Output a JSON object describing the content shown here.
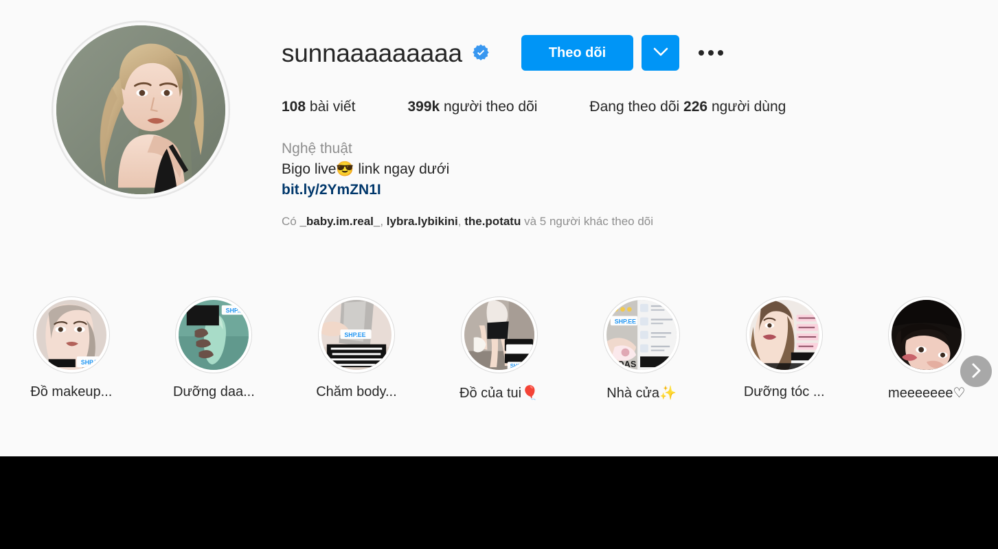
{
  "profile": {
    "username": "sunnaaaaaaaaa",
    "verified": true,
    "verified_icon": "verified-badge-icon",
    "avatar_alt": "profile-photo"
  },
  "actions": {
    "follow_label": "Theo dõi",
    "dropdown_icon": "chevron-down-icon",
    "more_icon": "more-options-icon",
    "accent_color": "#0095f6"
  },
  "stats": {
    "posts": {
      "count": "108",
      "label": "bài viết"
    },
    "followers": {
      "count": "399k",
      "label": "người theo dõi"
    },
    "following": {
      "prefix": "Đang theo dõi",
      "count": "226",
      "label": "người dùng"
    }
  },
  "bio": {
    "category": "Nghệ thuật",
    "line_text_before": "Bigo live",
    "line_emoji": "😎",
    "line_text_after": " link ngay dưới",
    "link": "bit.ly/2YmZN1I",
    "link_color": "#00376b"
  },
  "followed_by": {
    "prefix": "Có",
    "mutuals": [
      "_baby.im.real_",
      "lybra.lybikini",
      "the.potatu"
    ],
    "suffix": "và 5 người khác theo dõi"
  },
  "highlights": [
    {
      "label": "Đồ makeup...",
      "thumb": "makeup-thumb"
    },
    {
      "label": "Dưỡng daa...",
      "thumb": "skincare-thumb"
    },
    {
      "label": "Chăm body...",
      "thumb": "body-thumb"
    },
    {
      "label": "Đồ của tui🎈",
      "thumb": "outfit-thumb"
    },
    {
      "label": "Nhà cửa✨",
      "thumb": "home-thumb"
    },
    {
      "label": "Dưỡng tóc ...",
      "thumb": "hair-thumb"
    },
    {
      "label": "meeeeeee♡",
      "thumb": "me-thumb"
    }
  ],
  "carousel": {
    "next_icon": "chevron-right-icon"
  },
  "colors": {
    "page_background": "#fafafa",
    "bottom_band": "#000000",
    "text_primary": "#262626",
    "text_muted": "#8e8e8e"
  }
}
